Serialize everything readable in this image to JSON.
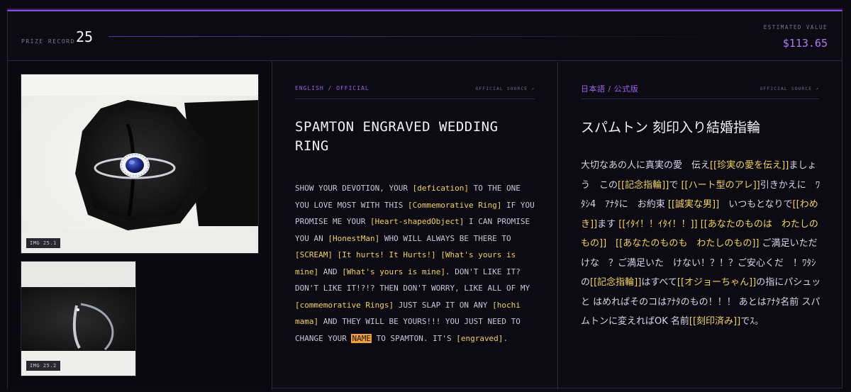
{
  "header": {
    "label": "PRIZE RECORD",
    "record_number": "25",
    "estimated_label": "ESTIMATED VALUE",
    "estimated_value": "$113.65"
  },
  "images": [
    {
      "tag": "IMG 25.1",
      "subject": "sapphire ring in black octagonal box"
    },
    {
      "tag": "IMG 25.2",
      "subject": "silver ring band side view"
    }
  ],
  "english": {
    "source_label": "ENGLISH / OFFICIAL",
    "source_link": "OFFICIAL SOURCE ↗",
    "title": "SPAMTON ENGRAVED WEDDING RING",
    "body": [
      {
        "t": "SHOW YOUR DEVOTION, YOUR "
      },
      {
        "t": "[defication]",
        "h": "hl"
      },
      {
        "t": " TO THE ONE YOU LOVE MOST WITH THIS "
      },
      {
        "t": "[Commemorative Ring]",
        "h": "hl"
      },
      {
        "t": " IF YOU PROMISE ME YOUR "
      },
      {
        "t": "[Heart-shapedObject]",
        "h": "hl"
      },
      {
        "t": " I CAN PROMISE YOU AN "
      },
      {
        "t": "[HonestMan]",
        "h": "hl"
      },
      {
        "t": " WHO WILL ALWAYS BE THERE TO "
      },
      {
        "t": "[SCREAM]",
        "h": "hl"
      },
      {
        "t": " "
      },
      {
        "t": "[It hurts! It Hurts!]",
        "h": "hl"
      },
      {
        "t": " "
      },
      {
        "t": "[What's yours is mine]",
        "h": "hl"
      },
      {
        "t": " AND "
      },
      {
        "t": "[What's yours is mine]",
        "h": "hl"
      },
      {
        "t": ". DON'T LIKE IT? DON'T LIKE IT!?!? THEN DON'T WORRY, LIKE ALL OF MY "
      },
      {
        "t": "[commemorative Rings]",
        "h": "hl"
      },
      {
        "t": " JUST SLAP IT ON ANY "
      },
      {
        "t": "[hochi mama]",
        "h": "hl"
      },
      {
        "t": " AND THEY WILL BE YOURS!!! YOU JUST NEED TO CHANGE YOUR "
      },
      {
        "t": "NAME",
        "h": "hl-name"
      },
      {
        "t": " TO SPAMTON. IT'S "
      },
      {
        "t": "[engraved]",
        "h": "hl"
      },
      {
        "t": "."
      }
    ]
  },
  "japanese": {
    "source_label": "日本語 / 公式版",
    "source_link": "OFFICIAL SOURCE ↗",
    "title": "スパムトン 刻印入り結婚指輪",
    "body": [
      {
        "t": "大切なあの人に真実の愛　伝え"
      },
      {
        "t": "[[珍実の愛を伝え]]",
        "h": "hl"
      },
      {
        "t": "ましょう　この"
      },
      {
        "t": "[[記念指輪]]",
        "h": "hl"
      },
      {
        "t": "で "
      },
      {
        "t": "[[ハート型のアレ]]",
        "h": "hl"
      },
      {
        "t": "引きかえに　ﾜﾀｼ4　ｱﾅﾀに　お約束 "
      },
      {
        "t": "[[誠実な男]]",
        "h": "hl"
      },
      {
        "t": "　いつもとなりで"
      },
      {
        "t": "[[わめき]]",
        "h": "hl"
      },
      {
        "t": "ます "
      },
      {
        "t": "[[ｲﾀｲ！！ｲﾀｲ！！]]",
        "h": "hl"
      },
      {
        "t": " "
      },
      {
        "t": "[[あなたのものは　わたしのもの]]",
        "h": "hl"
      },
      {
        "t": "　"
      },
      {
        "t": "[[あなたのものも　わたしのもの]]",
        "h": "hl"
      },
      {
        "t": " ご満足いただけな　？ご満足いた　けない！？！？ご安心くだ　！ﾜﾀｼの"
      },
      {
        "t": "[[記念指輪]]",
        "h": "hl"
      },
      {
        "t": "はすべて"
      },
      {
        "t": "[[オジョーちゃん]]",
        "h": "hl"
      },
      {
        "t": "の指にパシュッと はめればそのコはｱﾅﾀのもの！！！ あとはｱﾅﾀ名前 スパムトンに変えればOK 名前"
      },
      {
        "t": "[[刻印済み]]",
        "h": "hl"
      },
      {
        "t": "でｽ。"
      }
    ]
  },
  "colors": {
    "accent": "#8a4fe6",
    "price": "#b07cf2",
    "highlight": "#f2d35b",
    "name_highlight": "#f0a040",
    "background": "#0c0b14"
  }
}
